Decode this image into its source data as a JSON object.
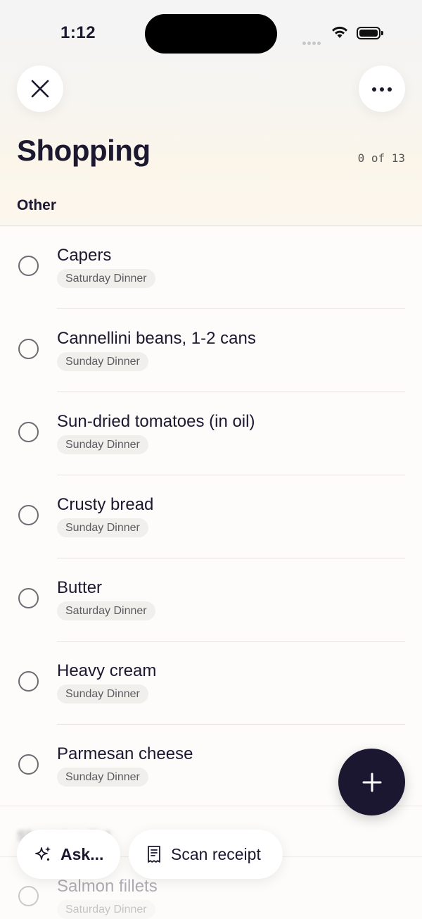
{
  "status_bar": {
    "time": "1:12"
  },
  "header": {
    "title": "Shopping",
    "counter": "0 of 13"
  },
  "sections": [
    {
      "label": "Other",
      "items": [
        {
          "name": "Capers",
          "tag": "Saturday Dinner"
        },
        {
          "name": "Cannellini beans, 1-2 cans",
          "tag": "Sunday Dinner"
        },
        {
          "name": "Sun-dried tomatoes (in oil)",
          "tag": "Sunday Dinner"
        },
        {
          "name": "Crusty bread",
          "tag": "Sunday Dinner"
        },
        {
          "name": "Butter",
          "tag": "Saturday Dinner"
        },
        {
          "name": "Heavy cream",
          "tag": "Sunday Dinner"
        },
        {
          "name": "Parmesan cheese",
          "tag": "Sunday Dinner"
        }
      ]
    },
    {
      "label": "Shopping list",
      "items": [
        {
          "name": "Salmon fillets",
          "tag": "Saturday Dinner"
        }
      ]
    }
  ],
  "actions": {
    "ask_label": "Ask...",
    "scan_label": "Scan receipt"
  },
  "icons": {
    "close": "close-icon",
    "more": "more-dots-icon",
    "add": "plus-icon",
    "ask": "sparkle-icon",
    "scan": "receipt-icon"
  },
  "colors": {
    "accent": "#1c1730",
    "text": "#1c1830",
    "tag_bg": "#f1efec"
  }
}
